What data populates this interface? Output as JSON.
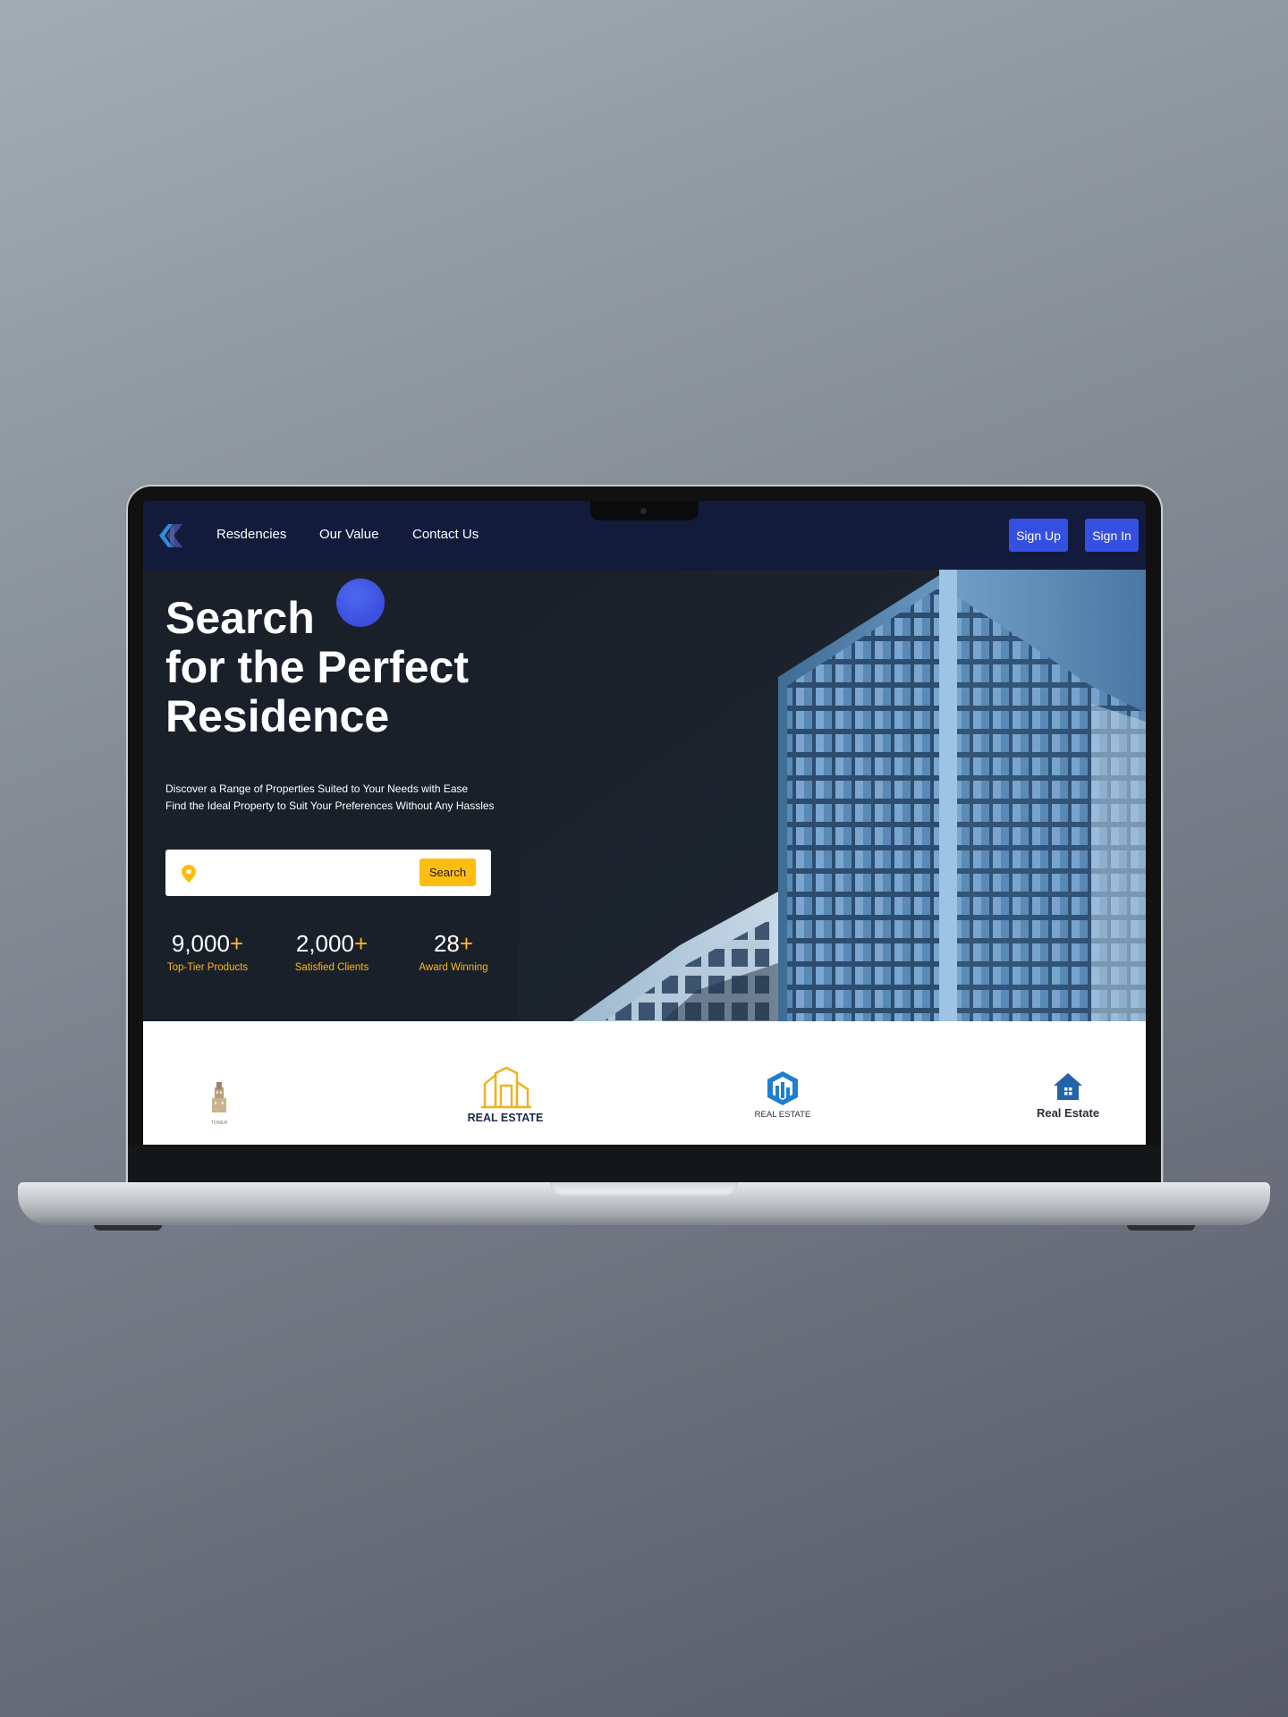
{
  "nav": {
    "links": [
      "Resdencies",
      "Our Value",
      "Contact Us"
    ],
    "signup_label": "Sign Up",
    "signin_label": "Sign In"
  },
  "hero": {
    "headline": [
      "Search",
      "for the Perfect",
      "Residence"
    ],
    "subtext": [
      "Discover a Range of Properties Suited to Your Needs with Ease",
      "Find the Ideal Property to Suit Your Preferences Without Any Hassles"
    ],
    "search": {
      "placeholder": "",
      "button_label": "Search"
    },
    "stats": [
      {
        "value": "9,000",
        "suffix": "+",
        "label": "Top-Tier Products"
      },
      {
        "value": "2,000",
        "suffix": "+",
        "label": "Satisfied Clients"
      },
      {
        "value": "28",
        "suffix": "+",
        "label": "Award Winning"
      }
    ]
  },
  "brands": [
    {
      "name": "tower-logo",
      "text": "TOWER"
    },
    {
      "name": "real-estate-logo-gold",
      "text": "REAL ESTATE"
    },
    {
      "name": "real-estate-logo-blue",
      "text": "REAL ESTATE"
    },
    {
      "name": "real-estate-logo-house",
      "text": "Real Estate"
    }
  ],
  "colors": {
    "nav_bg": "#131b3d",
    "hero_bg": "#1a202a",
    "accent_blue": "#3550e0",
    "accent_yellow": "#ffbd12"
  }
}
